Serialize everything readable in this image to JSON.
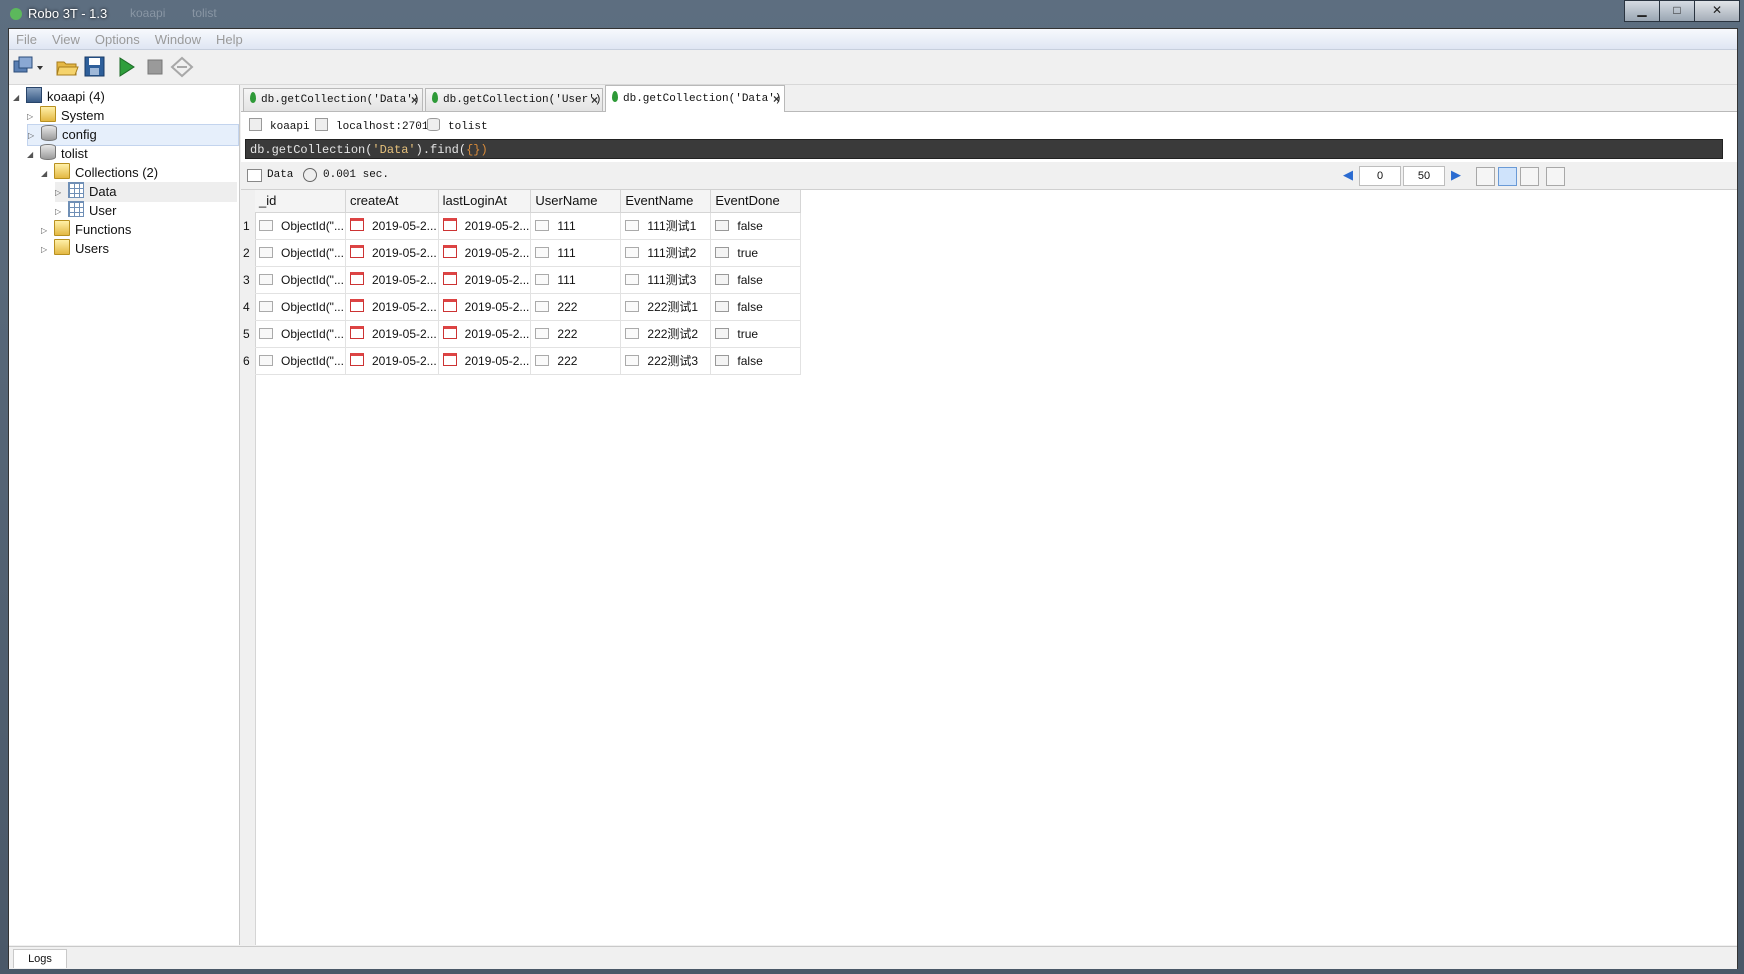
{
  "window": {
    "title": "Robo 3T - 1.3",
    "ghost_tabs": [
      "koaapi",
      "tolist"
    ],
    "controls": {
      "minimize": "▁",
      "maximize": "□",
      "close": "✕"
    }
  },
  "menubar": [
    "File",
    "View",
    "Options",
    "Window",
    "Help"
  ],
  "toolbar": [
    "connect-icon",
    "open-icon",
    "save-icon",
    "execute-icon",
    "stop-icon",
    "refresh-icon"
  ],
  "tree": {
    "root": "koaapi (4)",
    "system": "System",
    "config": "config",
    "tolist": "tolist",
    "collections": "Collections (2)",
    "data": "Data",
    "user": "User",
    "functions": "Functions",
    "users": "Users"
  },
  "tabs": [
    {
      "label": "db.getCollection('Data').…",
      "active": false
    },
    {
      "label": "db.getCollection('User')…",
      "active": false
    },
    {
      "label": "db.getCollection('Data').…",
      "active": true
    }
  ],
  "query": {
    "db": "koaapi",
    "host": "localhost:27017",
    "collection": "tolist",
    "editor_prefix": "db.getCollection(",
    "editor_string": "'Data'",
    "editor_mid": ").find(",
    "editor_braces": "{}",
    "editor_close": ")"
  },
  "result_bar": {
    "collection": "Data",
    "time": "0.001 sec.",
    "skip": "0",
    "limit": "50"
  },
  "table": {
    "columns": [
      "_id",
      "createAt",
      "lastLoginAt",
      "UserName",
      "EventName",
      "EventDone"
    ],
    "rows": [
      [
        "ObjectId(\"...",
        "2019-05-2...",
        "2019-05-2...",
        "111",
        "111测试1",
        "false"
      ],
      [
        "ObjectId(\"...",
        "2019-05-2...",
        "2019-05-2...",
        "111",
        "111测试2",
        "true"
      ],
      [
        "ObjectId(\"...",
        "2019-05-2...",
        "2019-05-2...",
        "111",
        "111测试3",
        "false"
      ],
      [
        "ObjectId(\"...",
        "2019-05-2...",
        "2019-05-2...",
        "222",
        "222测试1",
        "false"
      ],
      [
        "ObjectId(\"...",
        "2019-05-2...",
        "2019-05-2...",
        "222",
        "222测试2",
        "true"
      ],
      [
        "ObjectId(\"...",
        "2019-05-2...",
        "2019-05-2...",
        "222",
        "222测试3",
        "false"
      ]
    ],
    "row_numbers": [
      "1",
      "2",
      "3",
      "4",
      "5",
      "6"
    ]
  },
  "logs": {
    "label": "Logs"
  }
}
